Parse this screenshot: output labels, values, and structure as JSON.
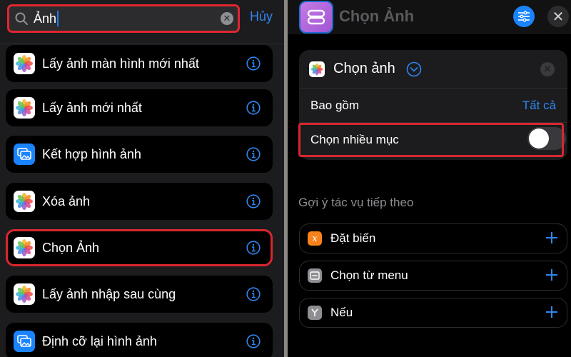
{
  "search": {
    "value": "Ảnh",
    "cancel_label": "Hủy"
  },
  "results": [
    {
      "label": "Lấy ảnh màn hình mới nhất",
      "icon": "photos-icon"
    },
    {
      "label": "Lấy ảnh mới nhất",
      "icon": "photos-icon"
    },
    {
      "label": "Kết hợp hình ảnh",
      "icon": "image-combine-icon"
    },
    {
      "label": "Xóa ảnh",
      "icon": "photos-icon"
    },
    {
      "label": "Chọn Ảnh",
      "icon": "photos-icon",
      "selected": true
    },
    {
      "label": "Lấy ảnh nhập sau cùng",
      "icon": "photos-icon"
    },
    {
      "label": "Định cỡ lại hình ảnh",
      "icon": "image-resize-icon"
    }
  ],
  "header": {
    "title": "Chọn Ảnh"
  },
  "action": {
    "title": "Chọn ảnh",
    "include_label": "Bao gồm",
    "include_value": "Tất cả",
    "multi_label": "Chọn nhiều mục",
    "multi_enabled": false
  },
  "suggestions": {
    "title": "Gợi ý tác vụ tiếp theo",
    "items": [
      {
        "label": "Đặt biến",
        "icon": "variable-icon",
        "color": "#f7821b"
      },
      {
        "label": "Chọn từ menu",
        "icon": "menu-icon",
        "color": "#8e8e93"
      },
      {
        "label": "Nếu",
        "icon": "if-branch-icon",
        "color": "#8e8e93"
      }
    ]
  },
  "colors": {
    "accent": "#2f86f0",
    "highlight": "#d9262f"
  }
}
